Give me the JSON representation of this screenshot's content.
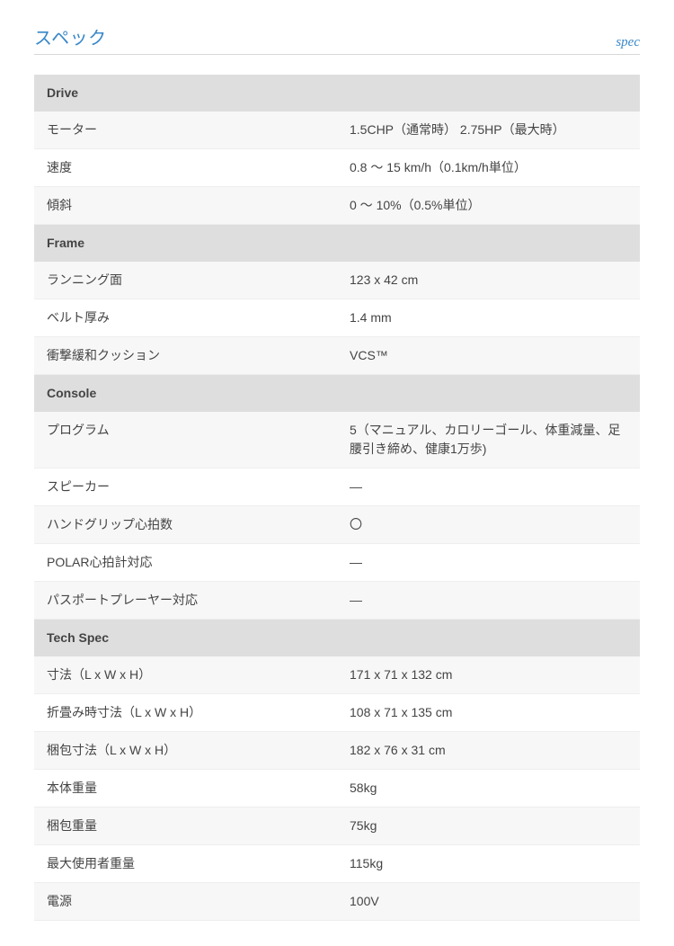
{
  "header": {
    "title": "スペック",
    "subtitle": "spec"
  },
  "sections": [
    {
      "title": "Drive",
      "rows": [
        {
          "label": "モーター",
          "value": "1.5CHP（通常時） 2.75HP（最大時）"
        },
        {
          "label": "速度",
          "value": "0.8 〜 15 km/h（0.1km/h単位）"
        },
        {
          "label": "傾斜",
          "value": "0 〜 10%（0.5%単位）"
        }
      ]
    },
    {
      "title": "Frame",
      "rows": [
        {
          "label": "ランニング面",
          "value": "123 x 42 cm"
        },
        {
          "label": "ベルト厚み",
          "value": "1.4 mm"
        },
        {
          "label": "衝撃緩和クッション",
          "value": "VCS™"
        }
      ]
    },
    {
      "title": "Console",
      "rows": [
        {
          "label": "プログラム",
          "value": "5（マニュアル、カロリーゴール、体重減量、足腰引き締め、健康1万歩)"
        },
        {
          "label": "スピーカー",
          "value": "—"
        },
        {
          "label": "ハンドグリップ心拍数",
          "value": "〇"
        },
        {
          "label": "POLAR心拍計対応",
          "value": "—"
        },
        {
          "label": "パスポートプレーヤー対応",
          "value": "—"
        }
      ]
    },
    {
      "title": "Tech Spec",
      "rows": [
        {
          "label": "寸法（L x W x H）",
          "value": "171 x 71 x 132 cm"
        },
        {
          "label": "折畳み時寸法（L x W x H）",
          "value": "108 x 71 x 135 cm"
        },
        {
          "label": "梱包寸法（L x W x H）",
          "value": "182 x 76 x 31 cm"
        },
        {
          "label": "本体重量",
          "value": "58kg"
        },
        {
          "label": "梱包重量",
          "value": "75kg"
        },
        {
          "label": "最大使用者重量",
          "value": "115kg"
        },
        {
          "label": "電源",
          "value": "100V"
        }
      ]
    }
  ]
}
